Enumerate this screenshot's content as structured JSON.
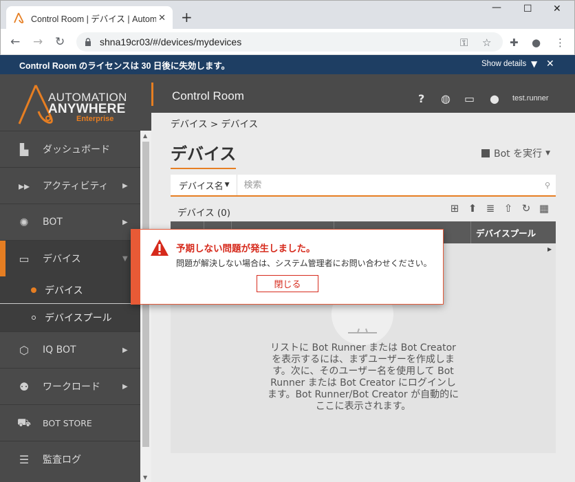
{
  "browser": {
    "tab_title": "Control Room | デバイス | Automation Anywhere",
    "new_tab_label": "+",
    "url": "shna19cr03/#/devices/mydevices"
  },
  "banner": {
    "text": "Control Room のライセンスは 30 日後に失効します。",
    "show_details": "Show details"
  },
  "logo": {
    "line1": "AUTOMATION",
    "line2": "ANYWHERE",
    "line3": "Enterprise"
  },
  "sidebar": {
    "items": [
      {
        "label": "ダッシュボード",
        "icon": "dashboard-icon"
      },
      {
        "label": "アクティビティ",
        "icon": "activity-icon"
      },
      {
        "label": "BOT",
        "icon": "bot-icon"
      },
      {
        "label": "デバイス",
        "icon": "laptop-icon"
      },
      {
        "label": "IQ BOT",
        "icon": "iq-bot-icon"
      },
      {
        "label": "ワークロード",
        "icon": "workload-icon"
      },
      {
        "label": "BOT STORE",
        "icon": "cart-icon"
      },
      {
        "label": "監査ログ",
        "icon": "list-icon"
      }
    ],
    "sub_items": [
      {
        "label": "デバイス"
      },
      {
        "label": "デバイスプール"
      }
    ]
  },
  "header": {
    "title": "Control Room",
    "user": "test.runner"
  },
  "main": {
    "breadcrumb": "デバイス > デバイス",
    "page_title": "デバイス",
    "run_bot": "Bot を実行",
    "search_field": "デバイス名",
    "search_placeholder": "検索",
    "device_count": "デバイス (0)",
    "columns": [
      "デバイスプール"
    ],
    "empty_message": "リストに Bot Runner または Bot Creator を表示するには、まずユーザーを作成します。次に、そのユーザー名を使用して Bot Runner または Bot Creator にログインします。Bot Runner/Bot Creator が自動的にここに表示されます。"
  },
  "dialog": {
    "title": "予期しない問題が発生しました。",
    "message": "問題が解決しない場合は、システム管理者にお問い合わせください。",
    "close_label": "閉じる"
  },
  "colors": {
    "accent": "#e67e22",
    "banner": "#1e3e63",
    "sidebar": "#4a4a4a",
    "error": "#d62a1c"
  }
}
